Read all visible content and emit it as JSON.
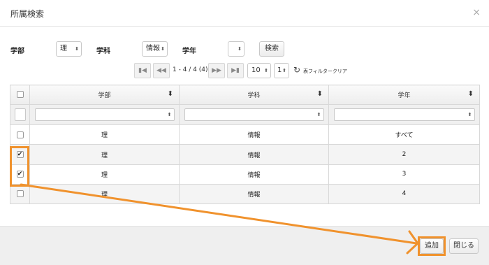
{
  "dialog": {
    "title": "所属検索",
    "close_icon": "×"
  },
  "filters": {
    "faculty_label": "学部",
    "faculty_value": "理",
    "department_label": "学科",
    "department_value": "情報",
    "year_label": "学年",
    "year_value": "",
    "search_button": "検索"
  },
  "pager": {
    "info": "1 - 4 / 4 (4)",
    "page_size": "10",
    "page": "1",
    "reset_label": "表フィルタークリア",
    "icons": [
      "first-page-icon",
      "prev-page-icon",
      "next-page-icon",
      "last-page-icon",
      "refresh-icon"
    ]
  },
  "table": {
    "columns": [
      "学部",
      "学科",
      "学年"
    ],
    "rows": [
      {
        "checked": false,
        "faculty": "理",
        "department": "情報",
        "year": "すべて"
      },
      {
        "checked": true,
        "faculty": "理",
        "department": "情報",
        "year": "2"
      },
      {
        "checked": true,
        "faculty": "理",
        "department": "情報",
        "year": "3"
      },
      {
        "checked": false,
        "faculty": "理",
        "department": "情報",
        "year": "4"
      }
    ]
  },
  "footer": {
    "add_button": "追加",
    "close_button": "閉じる"
  },
  "annotation": {
    "highlight_color": "#f0922d"
  }
}
